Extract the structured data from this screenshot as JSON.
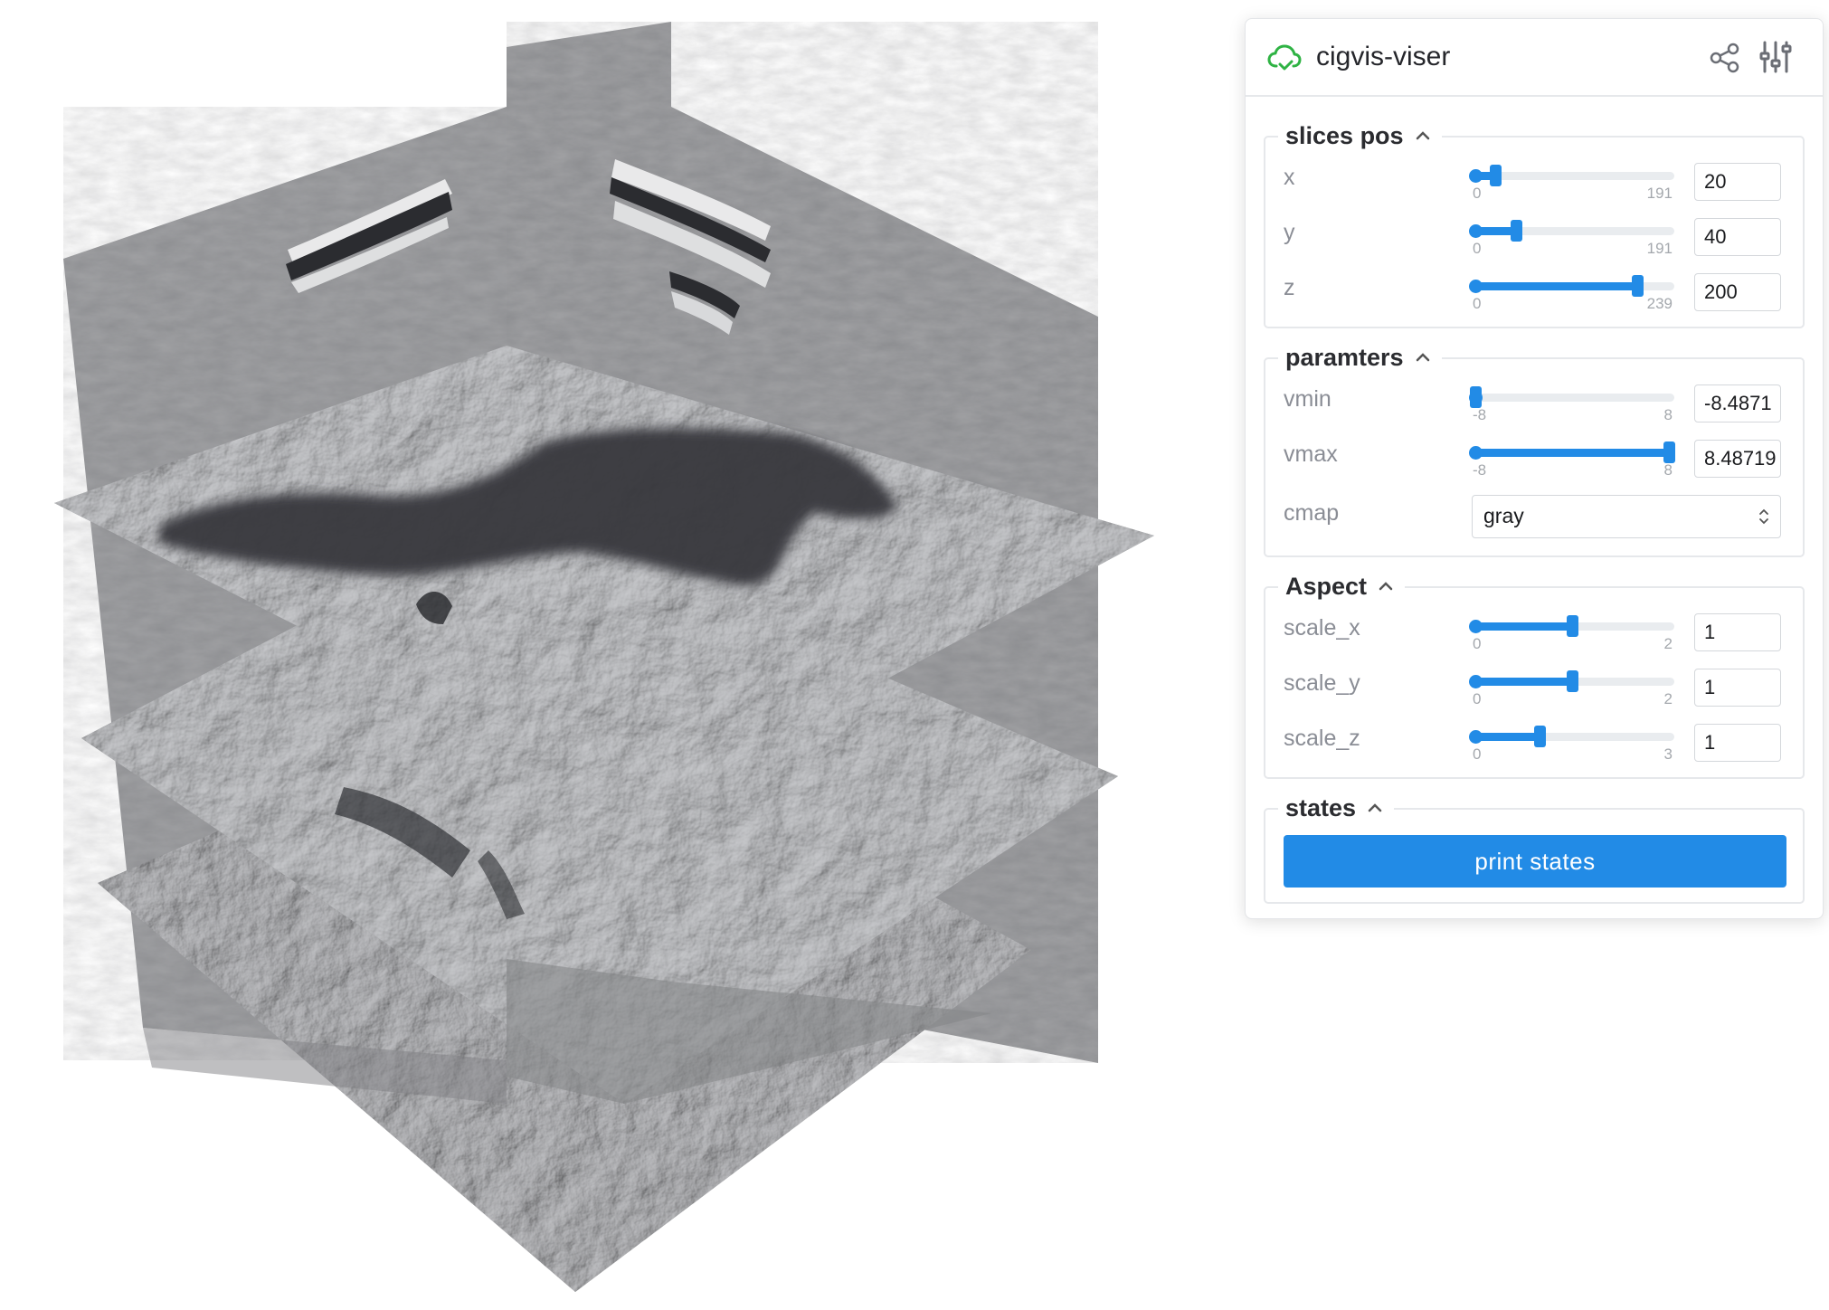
{
  "app": {
    "title": "cigvis-viser",
    "status_icon": "cloud-check-icon"
  },
  "header_icons": [
    "share-icon",
    "sliders-icon"
  ],
  "accent_color": "#228be6",
  "folders": {
    "slices": {
      "title": "slices pos",
      "rows": {
        "x": {
          "label": "x",
          "min": "0",
          "max": "191",
          "value": "20",
          "minv": 0,
          "maxv": 191,
          "v": 20
        },
        "y": {
          "label": "y",
          "min": "0",
          "max": "191",
          "value": "40",
          "minv": 0,
          "maxv": 191,
          "v": 40
        },
        "z": {
          "label": "z",
          "min": "0",
          "max": "239",
          "value": "200",
          "minv": 0,
          "maxv": 239,
          "v": 200
        }
      }
    },
    "params": {
      "title": "paramters",
      "rows": {
        "vmin": {
          "label": "vmin",
          "min": "-8",
          "max": "8",
          "value": "-8.4871",
          "minv": -8,
          "maxv": 8,
          "v": -8
        },
        "vmax": {
          "label": "vmax",
          "min": "-8",
          "max": "8",
          "value": "8.48719",
          "minv": -8,
          "maxv": 8,
          "v": 8
        }
      },
      "cmap": {
        "label": "cmap",
        "value": "gray"
      }
    },
    "aspect": {
      "title": "Aspect",
      "rows": {
        "sx": {
          "label": "scale_x",
          "min": "0",
          "max": "2",
          "value": "1",
          "minv": 0,
          "maxv": 2,
          "v": 1
        },
        "sy": {
          "label": "scale_y",
          "min": "0",
          "max": "2",
          "value": "1",
          "minv": 0,
          "maxv": 2,
          "v": 1
        },
        "sz": {
          "label": "scale_z",
          "min": "0",
          "max": "3",
          "value": "1",
          "minv": 0,
          "maxv": 3,
          "v": 1
        }
      }
    },
    "states": {
      "title": "states",
      "button_label": "print states"
    }
  }
}
